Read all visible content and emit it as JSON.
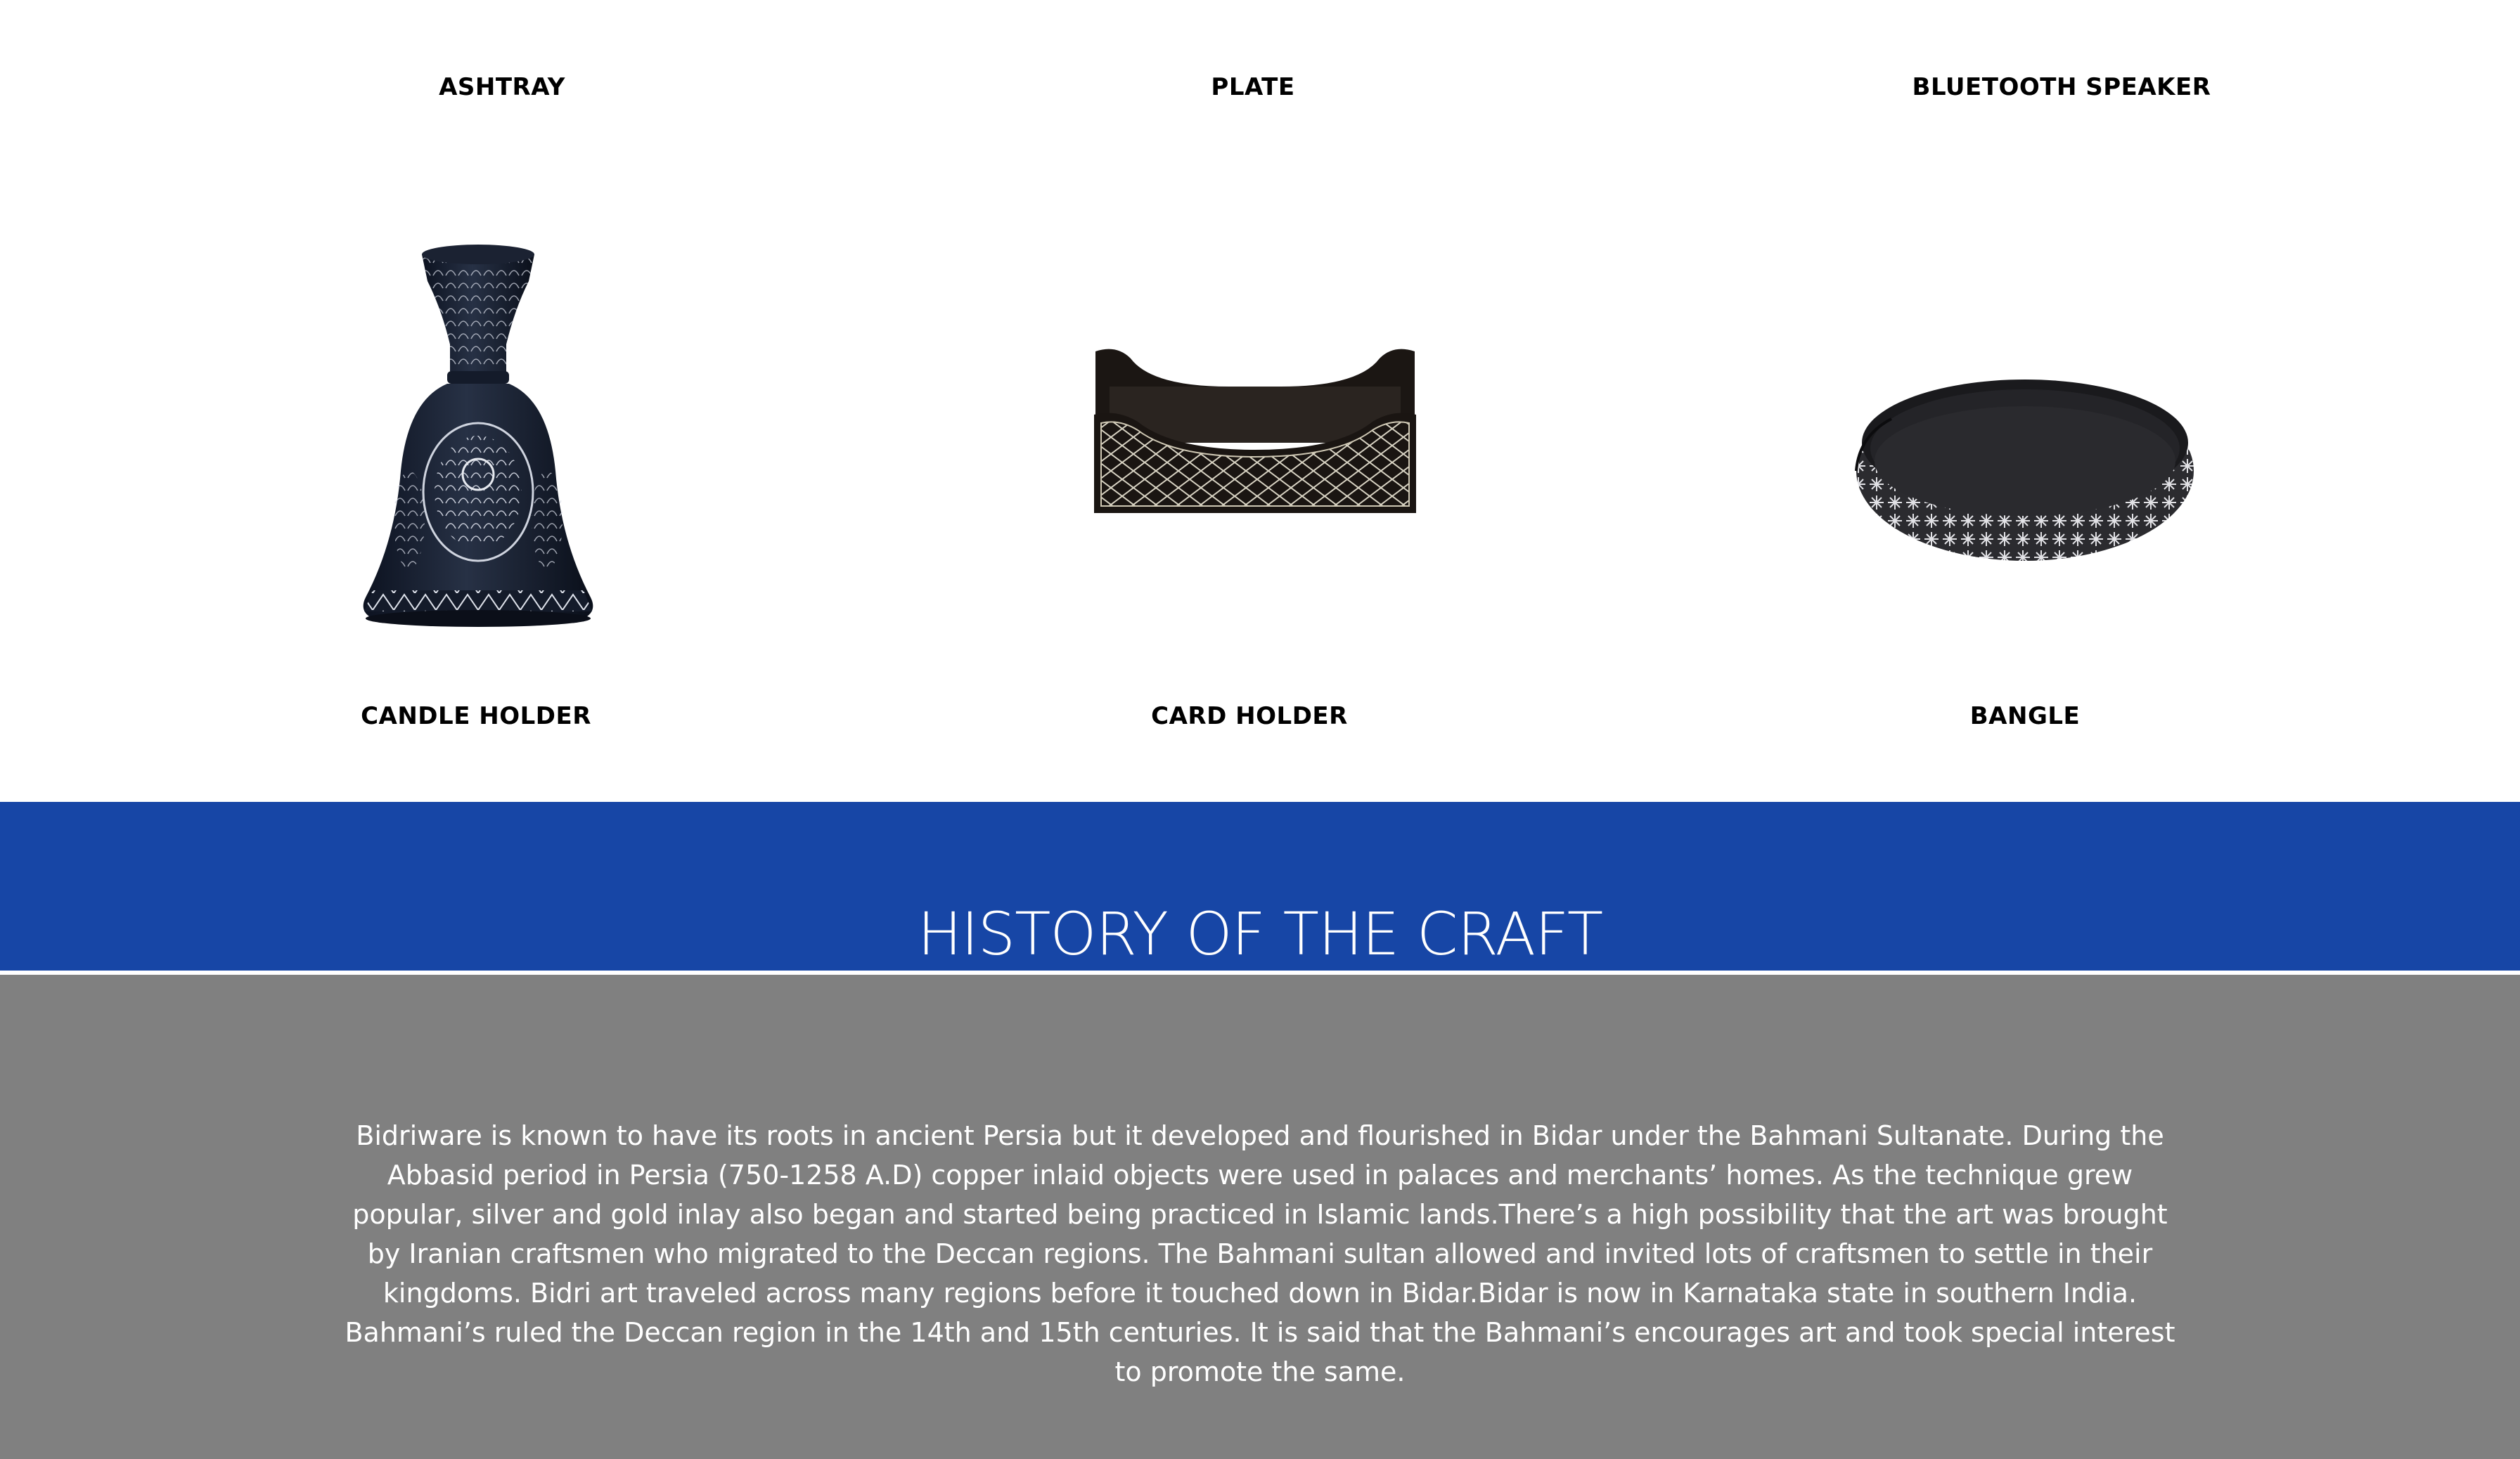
{
  "products": {
    "top_labels": [
      "ASHTRAY",
      "PLATE",
      "BLUETOOTH SPEAKER"
    ],
    "items": [
      {
        "label": "CANDLE HOLDER",
        "icon": "candle-holder-image"
      },
      {
        "label": "CARD HOLDER",
        "icon": "card-holder-image"
      },
      {
        "label": "BANGLE",
        "icon": "bangle-image"
      }
    ]
  },
  "history": {
    "title": "HISTORY OF THE CRAFT",
    "text": "Bidriware is known to have its roots in ancient Persia but it developed and flourished in Bidar under the Bahmani Sultanate. During the Abbasid period in Persia (750-1258 A.D) copper inlaid objects were used in palaces and merchants’ homes. As the technique grew popular, silver and gold inlay also began and started being practiced in Islamic lands.There’s a high possibility that the art was brought by Iranian craftsmen who migrated to the Deccan regions. The Bahmani sultan allowed and invited lots of craftsmen to settle in their kingdoms. Bidri art traveled across many regions before it touched down in Bidar.Bidar is now in Karnataka state in southern India. Bahmani’s ruled the Deccan region in the 14th and 15th centuries. It is said that the Bahmani’s encourages art and took special interest to promote the same.",
    "banner_color": "#1746a6",
    "body_color": "#808080"
  }
}
